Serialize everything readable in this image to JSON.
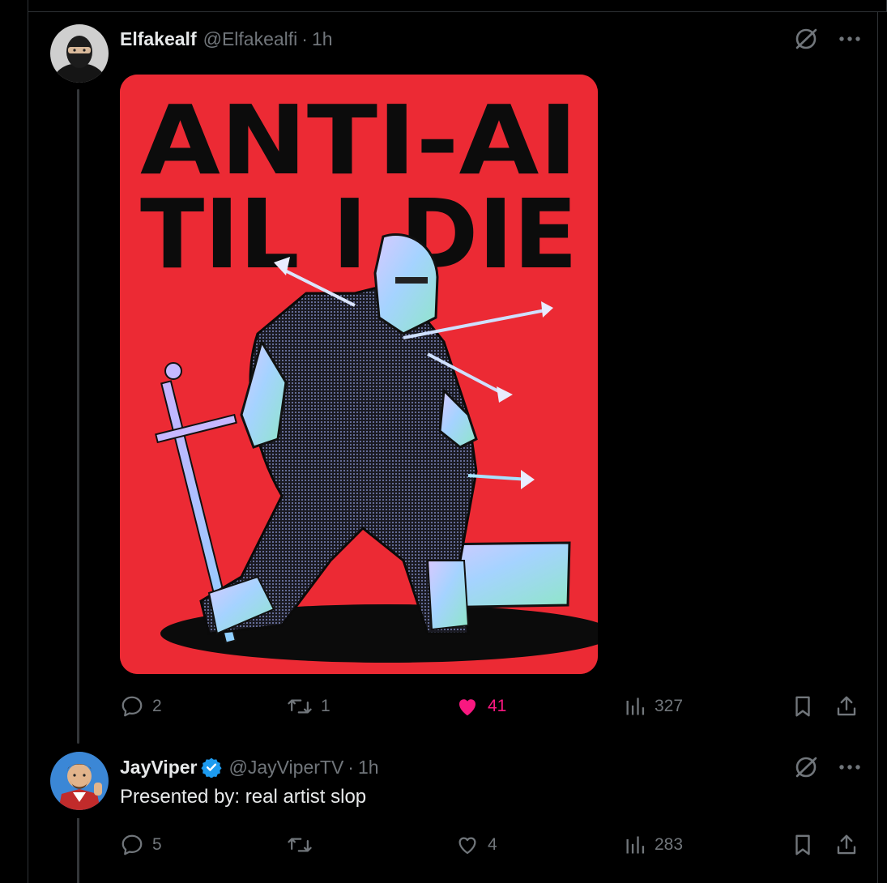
{
  "tweets": [
    {
      "name": "Elfakealf",
      "handle": "@Elfakealfi",
      "time": "1h",
      "verified": false,
      "media": {
        "headline_line1": "ANTI-AI",
        "headline_line2": "TIL I DIE"
      },
      "actions": {
        "replies": "2",
        "reposts": "1",
        "likes": "41",
        "liked": true,
        "views": "327"
      }
    },
    {
      "name": "JayViper",
      "handle": "@JayViperTV",
      "time": "1h",
      "verified": true,
      "text": "Presented by: real artist slop",
      "actions": {
        "replies": "5",
        "reposts": "",
        "likes": "4",
        "liked": false,
        "views": "283"
      }
    }
  ],
  "separator": "·",
  "colors": {
    "background": "#000000",
    "text": "#e7e9ea",
    "secondary": "#71767b",
    "like": "#f91880",
    "verified": "#1d9bf0",
    "poster": "#ec2a34"
  },
  "icons": [
    "grok-icon",
    "more-icon",
    "reply-icon",
    "repost-icon",
    "like-icon",
    "views-icon",
    "bookmark-icon",
    "share-icon"
  ]
}
